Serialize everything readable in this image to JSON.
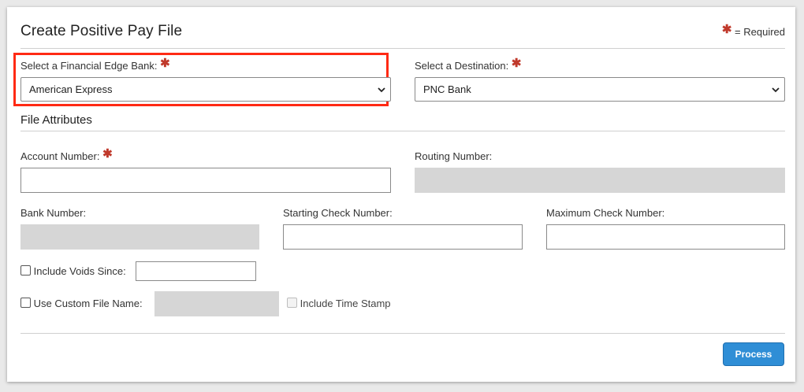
{
  "header": {
    "title": "Create Positive Pay File",
    "required_legend": "= Required"
  },
  "bank": {
    "label": "Select a Financial Edge Bank:",
    "selected": "American Express"
  },
  "destination": {
    "label": "Select a Destination:",
    "selected": "PNC Bank"
  },
  "file_attributes": {
    "heading": "File Attributes",
    "account_number_label": "Account Number:",
    "account_number_value": "",
    "routing_number_label": "Routing Number:",
    "bank_number_label": "Bank Number:",
    "starting_check_label": "Starting Check Number:",
    "starting_check_value": "",
    "max_check_label": "Maximum Check Number:",
    "max_check_value": ""
  },
  "options": {
    "include_voids_label": "Include Voids Since:",
    "include_voids_checked": false,
    "custom_file_name_label": "Use Custom File Name:",
    "custom_file_name_checked": false,
    "include_time_stamp_label": "Include Time Stamp",
    "include_time_stamp_checked": false
  },
  "actions": {
    "process_label": "Process",
    "process_color": "#2f8ed6"
  },
  "colors": {
    "required_star": "#c0392b",
    "highlight_border": "#ff2a14"
  }
}
